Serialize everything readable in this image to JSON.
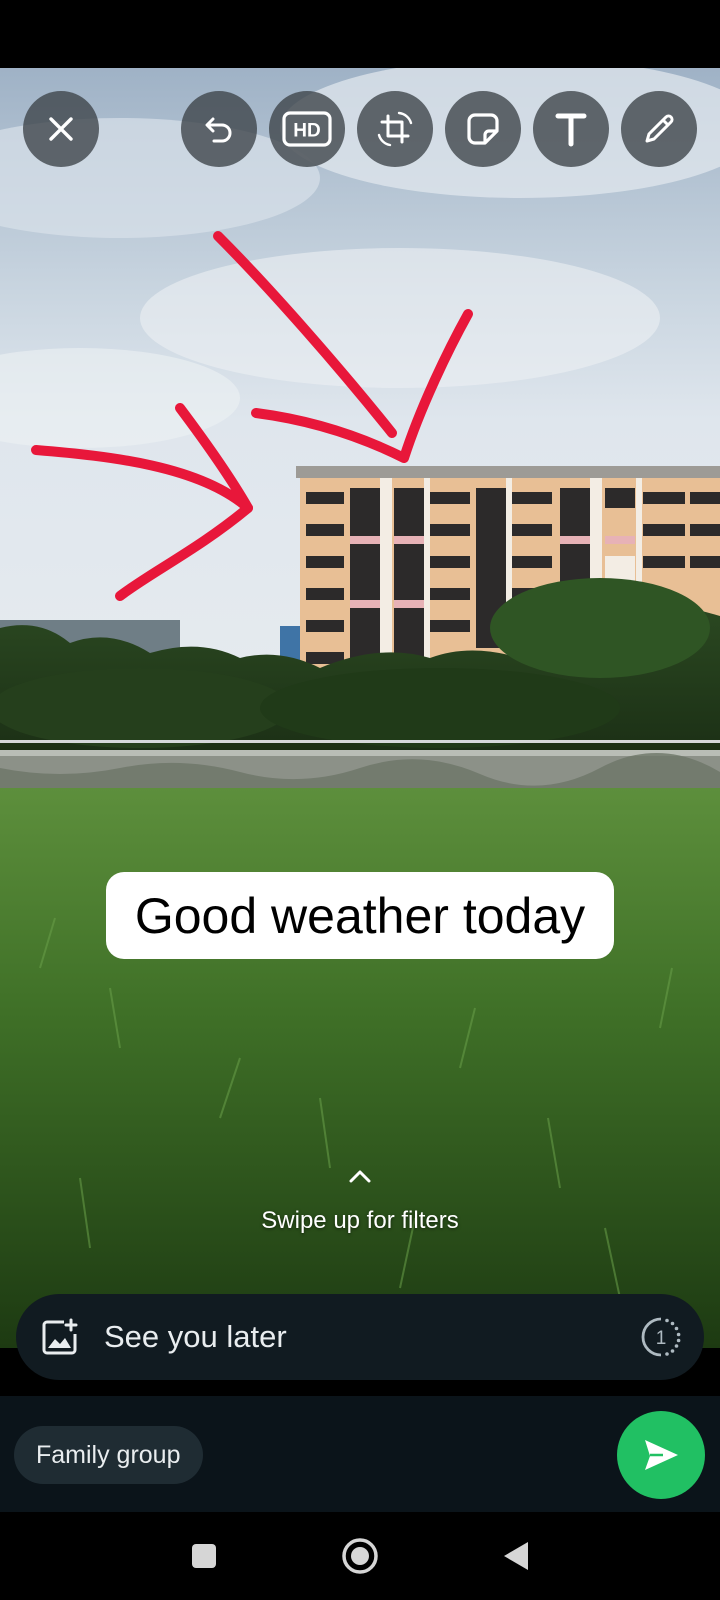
{
  "photo": {
    "text_sticker": "Good weather today",
    "drawing_color": "#e8173a"
  },
  "toolbar": {
    "close": "close-icon",
    "undo": "undo-icon",
    "hd": "HD",
    "crop": "crop-rotate-icon",
    "sticker": "sticker-icon",
    "text": "text-icon",
    "draw": "pencil-icon"
  },
  "filters_hint": {
    "label": "Swipe up for filters"
  },
  "caption": {
    "value": "See you later",
    "view_once_label": "1"
  },
  "recipient": {
    "label": "Family group"
  },
  "colors": {
    "send_button": "#21c063",
    "caption_bar": "#111b21",
    "bottom_panel": "#0b141a"
  }
}
